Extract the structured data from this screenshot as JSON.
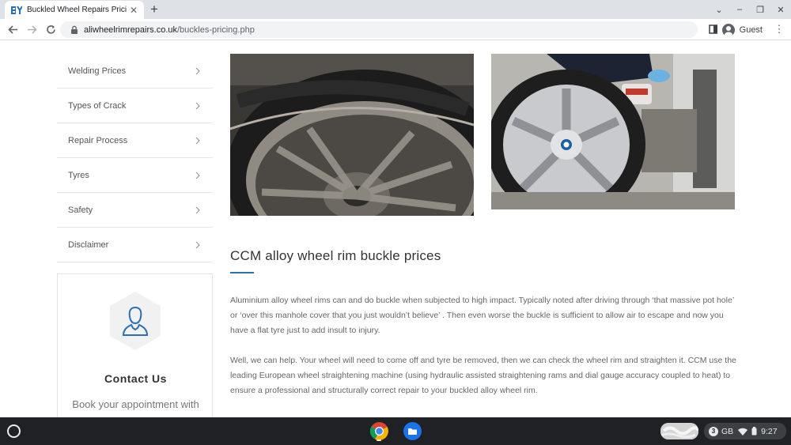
{
  "browser": {
    "tab": {
      "title": "Buckled Wheel Repairs Pricing | A"
    },
    "url": {
      "domain": "aliwheelrimrepairs.co.uk",
      "path": "/buckles-pricing.php"
    },
    "profile_label": "Guest"
  },
  "sidebar": {
    "items": [
      {
        "label": "Welding Prices"
      },
      {
        "label": "Types of Crack"
      },
      {
        "label": "Repair Process"
      },
      {
        "label": "Tyres"
      },
      {
        "label": "Safety"
      },
      {
        "label": "Disclaimer"
      }
    ]
  },
  "contact": {
    "title": "Contact Us",
    "subtitle": "Book your appointment with"
  },
  "main": {
    "heading": "CCM alloy wheel rim buckle prices",
    "paragraphs": [
      "Aluminium alloy wheel rims can and do buckle when subjected to high impact. Typically noted after driving through ‘that massive pot hole’ or ‘over this manhole cover that you just wouldn’t believe’ . Then even worse the buckle is sufficient to allow air to escape and now you have a flat tyre just to add insult to injury.",
      "Well, we can help. Your wheel will need to come off and tyre be removed, then we can check the wheel rim and straighten it. CCM use the leading European wheel straightening machine (using hydraulic assisted straightening rams and dial gauge accuracy coupled to heat) to ensure a professional and structurally correct repair to your buckled alloy wheel rim."
    ],
    "photos": [
      {
        "alt_icon": "buckled-tyre-photo"
      },
      {
        "alt_icon": "bmw-wheel-straightening-photo"
      }
    ]
  },
  "taskbar": {
    "notification_count": "3",
    "storage_label": "GB",
    "time": "9:27"
  },
  "colors": {
    "accent": "#2a6fb5",
    "tabstrip": "#dee1e6",
    "taskbar": "#202124"
  }
}
